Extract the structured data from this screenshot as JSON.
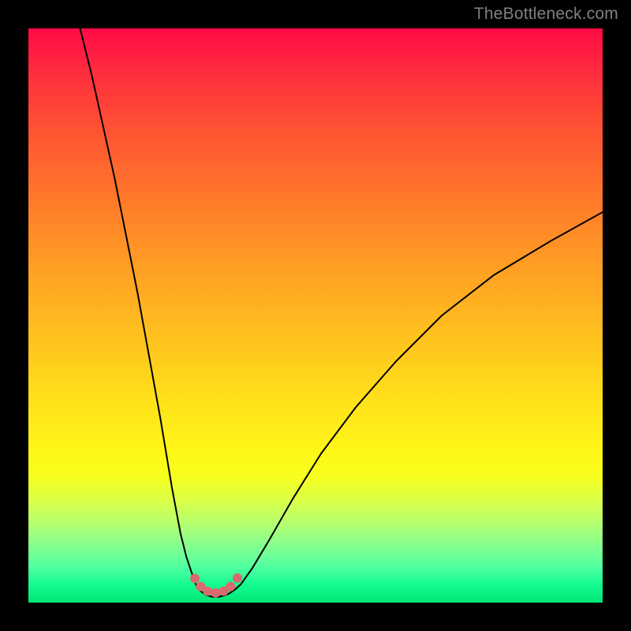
{
  "watermark": "TheBottleneck.com",
  "chart_data": {
    "type": "line",
    "title": "",
    "xlabel": "",
    "ylabel": "",
    "xlim": [
      0,
      100
    ],
    "ylim": [
      0,
      100
    ],
    "grid": false,
    "series": [
      {
        "name": "left-branch",
        "x": [
          9,
          11,
          13,
          15,
          17,
          19,
          21,
          23,
          25,
          26.5,
          27.5,
          28.5,
          29,
          29.5,
          30
        ],
        "y": [
          100,
          92,
          83,
          74,
          64,
          54,
          43,
          32,
          20,
          12,
          8,
          5,
          3.5,
          2.5,
          2
        ]
      },
      {
        "name": "valley",
        "x": [
          30,
          31,
          32,
          33,
          34,
          35,
          36,
          37
        ],
        "y": [
          2,
          1.3,
          1,
          1,
          1.2,
          1.6,
          2.3,
          3.2
        ]
      },
      {
        "name": "right-branch",
        "x": [
          37,
          39,
          42,
          46,
          51,
          57,
          64,
          72,
          81,
          91,
          100
        ],
        "y": [
          3.2,
          6,
          11,
          18,
          26,
          34,
          42,
          50,
          57,
          63,
          68
        ]
      }
    ],
    "markers": {
      "name": "valley-dots",
      "color": "#d96a6f",
      "points": [
        {
          "x": 29.0,
          "y": 4.2
        },
        {
          "x": 30.0,
          "y": 2.8
        },
        {
          "x": 31.2,
          "y": 2.0
        },
        {
          "x": 32.6,
          "y": 1.7
        },
        {
          "x": 34.0,
          "y": 2.0
        },
        {
          "x": 35.2,
          "y": 2.8
        },
        {
          "x": 36.4,
          "y": 4.3
        }
      ]
    },
    "background_gradient": {
      "stops": [
        {
          "pos": 0.0,
          "color": "#ff0a46"
        },
        {
          "pos": 0.3,
          "color": "#ff7a2a"
        },
        {
          "pos": 0.66,
          "color": "#ffe41a"
        },
        {
          "pos": 0.82,
          "color": "#dcff45"
        },
        {
          "pos": 1.0,
          "color": "#00e676"
        }
      ]
    }
  }
}
